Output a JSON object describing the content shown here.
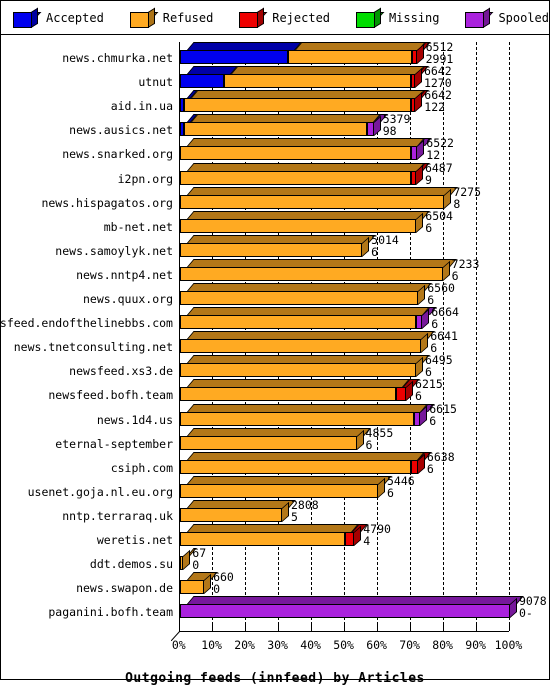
{
  "legend": {
    "items": [
      {
        "label": "Accepted",
        "color": "#0000ee",
        "icon": "cube-icon"
      },
      {
        "label": "Refused",
        "color": "#ffaa22",
        "icon": "cube-icon"
      },
      {
        "label": "Rejected",
        "color": "#ee0000",
        "icon": "cube-icon"
      },
      {
        "label": "Missing",
        "color": "#00dd00",
        "icon": "cube-icon"
      },
      {
        "label": "Spooled",
        "color": "#aa22dd",
        "icon": "cube-icon"
      }
    ]
  },
  "chart_data": {
    "type": "bar",
    "orientation": "horizontal",
    "stacked": true,
    "title": "Outgoing feeds (innfeed) by Articles",
    "xlabel": "",
    "ylabel": "",
    "xlim": [
      0,
      100
    ],
    "xunit": "%",
    "grid": true,
    "legend_position": "top",
    "xticks": [
      "0%",
      "10%",
      "20%",
      "30%",
      "40%",
      "50%",
      "60%",
      "70%",
      "80%",
      "90%",
      "100%"
    ],
    "xtick_values": [
      0,
      10,
      20,
      30,
      40,
      50,
      60,
      70,
      80,
      90,
      100
    ],
    "series": [
      {
        "name": "Accepted",
        "color": "#0000ee"
      },
      {
        "name": "Refused",
        "color": "#ffaa22"
      },
      {
        "name": "Rejected",
        "color": "#ee0000"
      },
      {
        "name": "Missing",
        "color": "#00dd00"
      },
      {
        "name": "Spooled",
        "color": "#aa22dd"
      }
    ],
    "max_total": 9078,
    "categories": [
      "news.chmurka.net",
      "utnut",
      "aid.in.ua",
      "news.ausics.net",
      "news.snarked.org",
      "i2pn.org",
      "news.hispagatos.org",
      "mb-net.net",
      "news.samoylyk.net",
      "news.nntp4.net",
      "news.quux.org",
      "newsfeed.endofthelinebbs.com",
      "news.tnetconsulting.net",
      "newsfeed.xs3.de",
      "newsfeed.bofh.team",
      "news.1d4.us",
      "eternal-september",
      "csiph.com",
      "usenet.goja.nl.eu.org",
      "nntp.terraraq.uk",
      "weretis.net",
      "ddt.demos.su",
      "news.swapon.de",
      "paganini.bofh.team"
    ],
    "rows": [
      {
        "feed": "news.chmurka.net",
        "label_top": "6512",
        "label_bottom": "2991",
        "total": 6512,
        "segments": [
          {
            "series": "Accepted",
            "pct": 32.6
          },
          {
            "series": "Refused",
            "pct": 37.6
          },
          {
            "series": "Rejected",
            "pct": 1.5
          }
        ]
      },
      {
        "feed": "utnut",
        "label_top": "6642",
        "label_bottom": "1270",
        "total": 6642,
        "segments": [
          {
            "series": "Accepted",
            "pct": 13.4
          },
          {
            "series": "Refused",
            "pct": 56.6
          },
          {
            "series": "Rejected",
            "pct": 1.2
          }
        ]
      },
      {
        "feed": "aid.in.ua",
        "label_top": "6642",
        "label_bottom": "122",
        "total": 6642,
        "segments": [
          {
            "series": "Accepted",
            "pct": 1.3
          },
          {
            "series": "Refused",
            "pct": 68.8
          },
          {
            "series": "Rejected",
            "pct": 1.2
          }
        ]
      },
      {
        "feed": "news.ausics.net",
        "label_top": "5379",
        "label_bottom": "98",
        "total": 5379,
        "segments": [
          {
            "series": "Accepted",
            "pct": 1.1
          },
          {
            "series": "Refused",
            "pct": 55.6
          },
          {
            "series": "Spooled",
            "pct": 2.0
          }
        ]
      },
      {
        "feed": "news.snarked.org",
        "label_top": "6522",
        "label_bottom": "12",
        "total": 6522,
        "segments": [
          {
            "series": "Refused",
            "pct": 69.9
          },
          {
            "series": "Spooled",
            "pct": 2.0
          }
        ]
      },
      {
        "feed": "i2pn.org",
        "label_top": "6487",
        "label_bottom": "9",
        "total": 6487,
        "segments": [
          {
            "series": "Refused",
            "pct": 69.9
          },
          {
            "series": "Rejected",
            "pct": 1.6
          }
        ]
      },
      {
        "feed": "news.hispagatos.org",
        "label_top": "7275",
        "label_bottom": "8",
        "total": 7275,
        "segments": [
          {
            "series": "Refused",
            "pct": 80.1
          }
        ]
      },
      {
        "feed": "mb-net.net",
        "label_top": "6504",
        "label_bottom": "6",
        "total": 6504,
        "segments": [
          {
            "series": "Refused",
            "pct": 71.6
          }
        ]
      },
      {
        "feed": "news.samoylyk.net",
        "label_top": "5014",
        "label_bottom": "6",
        "total": 5014,
        "segments": [
          {
            "series": "Refused",
            "pct": 55.2
          }
        ]
      },
      {
        "feed": "news.nntp4.net",
        "label_top": "7233",
        "label_bottom": "6",
        "total": 7233,
        "segments": [
          {
            "series": "Refused",
            "pct": 79.6
          }
        ]
      },
      {
        "feed": "news.quux.org",
        "label_top": "6560",
        "label_bottom": "6",
        "total": 6560,
        "segments": [
          {
            "series": "Refused",
            "pct": 72.2
          }
        ]
      },
      {
        "feed": "newsfeed.endofthelinebbs.com",
        "label_top": "6664",
        "label_bottom": "6",
        "total": 6664,
        "segments": [
          {
            "series": "Refused",
            "pct": 71.4
          },
          {
            "series": "Spooled",
            "pct": 2.0
          }
        ]
      },
      {
        "feed": "news.tnetconsulting.net",
        "label_top": "6641",
        "label_bottom": "6",
        "total": 6641,
        "segments": [
          {
            "series": "Refused",
            "pct": 73.1
          }
        ]
      },
      {
        "feed": "newsfeed.xs3.de",
        "label_top": "6495",
        "label_bottom": "6",
        "total": 6495,
        "segments": [
          {
            "series": "Refused",
            "pct": 71.5
          }
        ]
      },
      {
        "feed": "newsfeed.bofh.team",
        "label_top": "6215",
        "label_bottom": "6",
        "total": 6215,
        "segments": [
          {
            "series": "Refused",
            "pct": 65.5
          },
          {
            "series": "Rejected",
            "pct": 3.0
          }
        ]
      },
      {
        "feed": "news.1d4.us",
        "label_top": "6615",
        "label_bottom": "6",
        "total": 6615,
        "segments": [
          {
            "series": "Refused",
            "pct": 70.8
          },
          {
            "series": "Spooled",
            "pct": 2.0
          }
        ]
      },
      {
        "feed": "eternal-september",
        "label_top": "4855",
        "label_bottom": "6",
        "total": 4855,
        "segments": [
          {
            "series": "Refused",
            "pct": 53.5
          }
        ]
      },
      {
        "feed": "csiph.com",
        "label_top": "6638",
        "label_bottom": "6",
        "total": 6638,
        "segments": [
          {
            "series": "Refused",
            "pct": 70.1
          },
          {
            "series": "Rejected",
            "pct": 2.0
          }
        ]
      },
      {
        "feed": "usenet.goja.nl.eu.org",
        "label_top": "5446",
        "label_bottom": "6",
        "total": 5446,
        "segments": [
          {
            "series": "Refused",
            "pct": 60.0
          }
        ]
      },
      {
        "feed": "nntp.terraraq.uk",
        "label_top": "2808",
        "label_bottom": "5",
        "total": 2808,
        "segments": [
          {
            "series": "Refused",
            "pct": 30.9
          }
        ]
      },
      {
        "feed": "weretis.net",
        "label_top": "4790",
        "label_bottom": "4",
        "total": 4790,
        "segments": [
          {
            "series": "Refused",
            "pct": 50.0
          },
          {
            "series": "Rejected",
            "pct": 2.8
          }
        ]
      },
      {
        "feed": "ddt.demos.su",
        "label_top": "67",
        "label_bottom": "0",
        "total": 67,
        "segments": [
          {
            "series": "Refused",
            "pct": 1.0
          }
        ]
      },
      {
        "feed": "news.swapon.de",
        "label_top": "660",
        "label_bottom": "0",
        "total": 660,
        "segments": [
          {
            "series": "Refused",
            "pct": 7.3
          }
        ]
      },
      {
        "feed": "paganini.bofh.team",
        "label_top": "9078",
        "label_bottom": "0-",
        "total": 9078,
        "segments": [
          {
            "series": "Spooled",
            "pct": 100.0
          }
        ]
      }
    ]
  }
}
